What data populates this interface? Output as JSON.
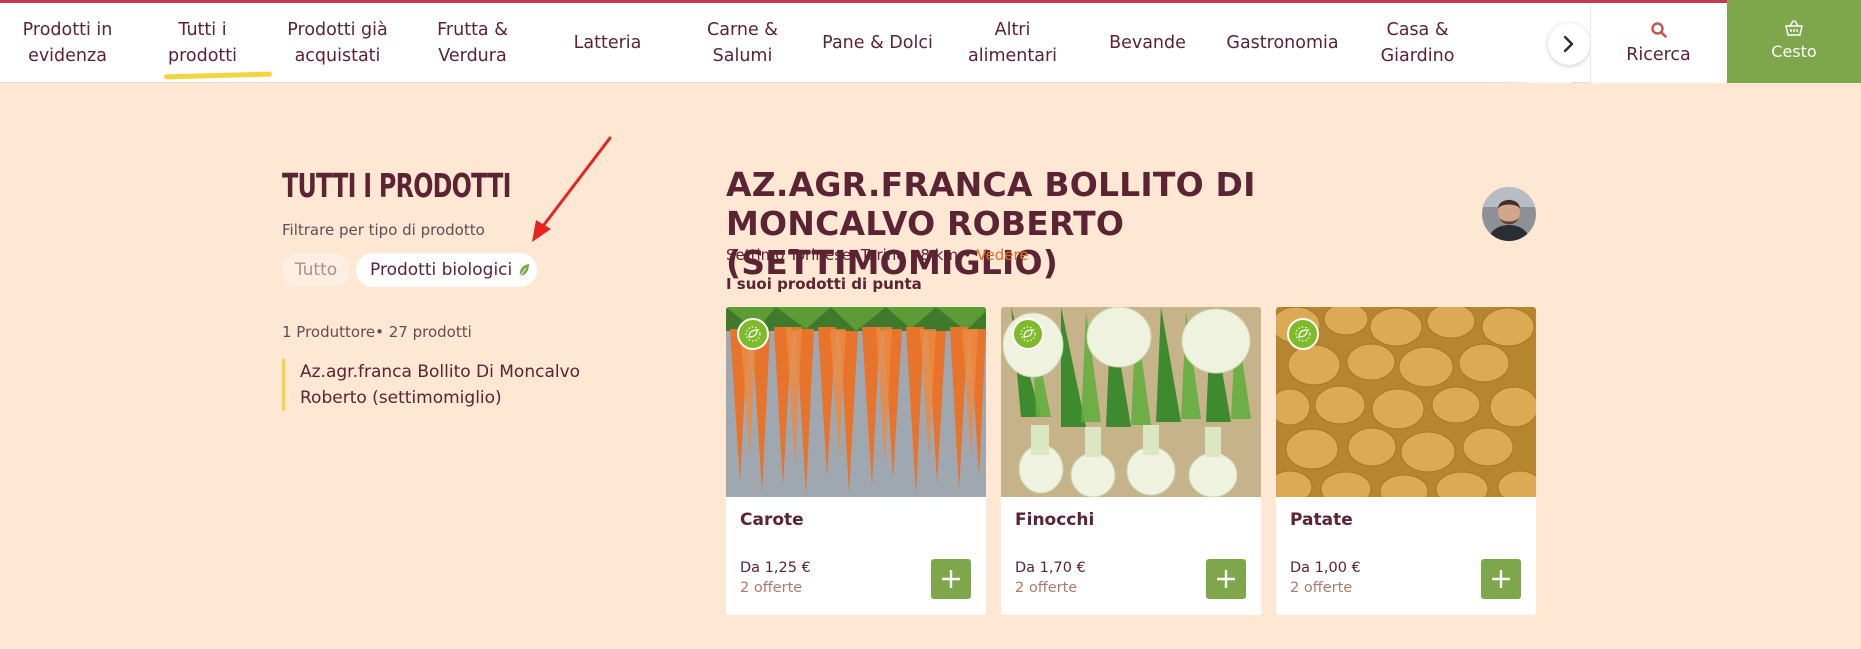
{
  "nav": {
    "items": [
      {
        "label": "Prodotti in\nevidenza"
      },
      {
        "label": "Tutti i\nprodotti"
      },
      {
        "label": "Prodotti già\nacquistati"
      },
      {
        "label": "Frutta &\nVerdura"
      },
      {
        "label": "Latteria"
      },
      {
        "label": "Carne &\nSalumi"
      },
      {
        "label": "Pane & Dolci"
      },
      {
        "label": "Altri\nalimentari"
      },
      {
        "label": "Bevande"
      },
      {
        "label": "Gastronomia"
      },
      {
        "label": "Casa &\nGiardino"
      }
    ],
    "active_index": 1,
    "search_label": "Ricerca",
    "cart_label": "Cesto"
  },
  "sidebar": {
    "title": "TUTTI I PRODOTTI",
    "filter_label": "Filtrare per tipo di prodotto",
    "chip_all": "Tutto",
    "chip_bio": "Prodotti biologici",
    "counts": "1 Produttore• 27 prodotti",
    "producer": "Az.agr.franca Bollito Di Moncalvo Roberto (settimomiglio)"
  },
  "farm": {
    "title": "AZ.AGR.FRANCA BOLLITO DI MONCALVO ROBERTO (SETTIMOMIGLIO)",
    "location": "Settimo Torinese, Torino - 8 km •",
    "see_label": "Vedere",
    "top_products_label": "I suoi prodotti di punta"
  },
  "products": [
    {
      "name": "Carote",
      "price": "Da 1,25 €",
      "offers": "2 offerte"
    },
    {
      "name": "Finocchi",
      "price": "Da 1,70 €",
      "offers": "2 offerte"
    },
    {
      "name": "Patate",
      "price": "Da 1,00 €",
      "offers": "2 offerte"
    }
  ],
  "colors": {
    "background": "#fee7d3",
    "text": "#5b2333",
    "accent_green": "#7ea64a",
    "link_orange": "#e2702c",
    "highlight_yellow": "#f5d53f",
    "annotation_red": "#e8231f"
  },
  "icons": {
    "nav_next": "chevron-right-icon",
    "search": "search-icon",
    "cart": "basket-icon",
    "bio": "leaf-icon",
    "add": "plus-icon",
    "organic_badge": "eu-organic-leaf-icon"
  }
}
